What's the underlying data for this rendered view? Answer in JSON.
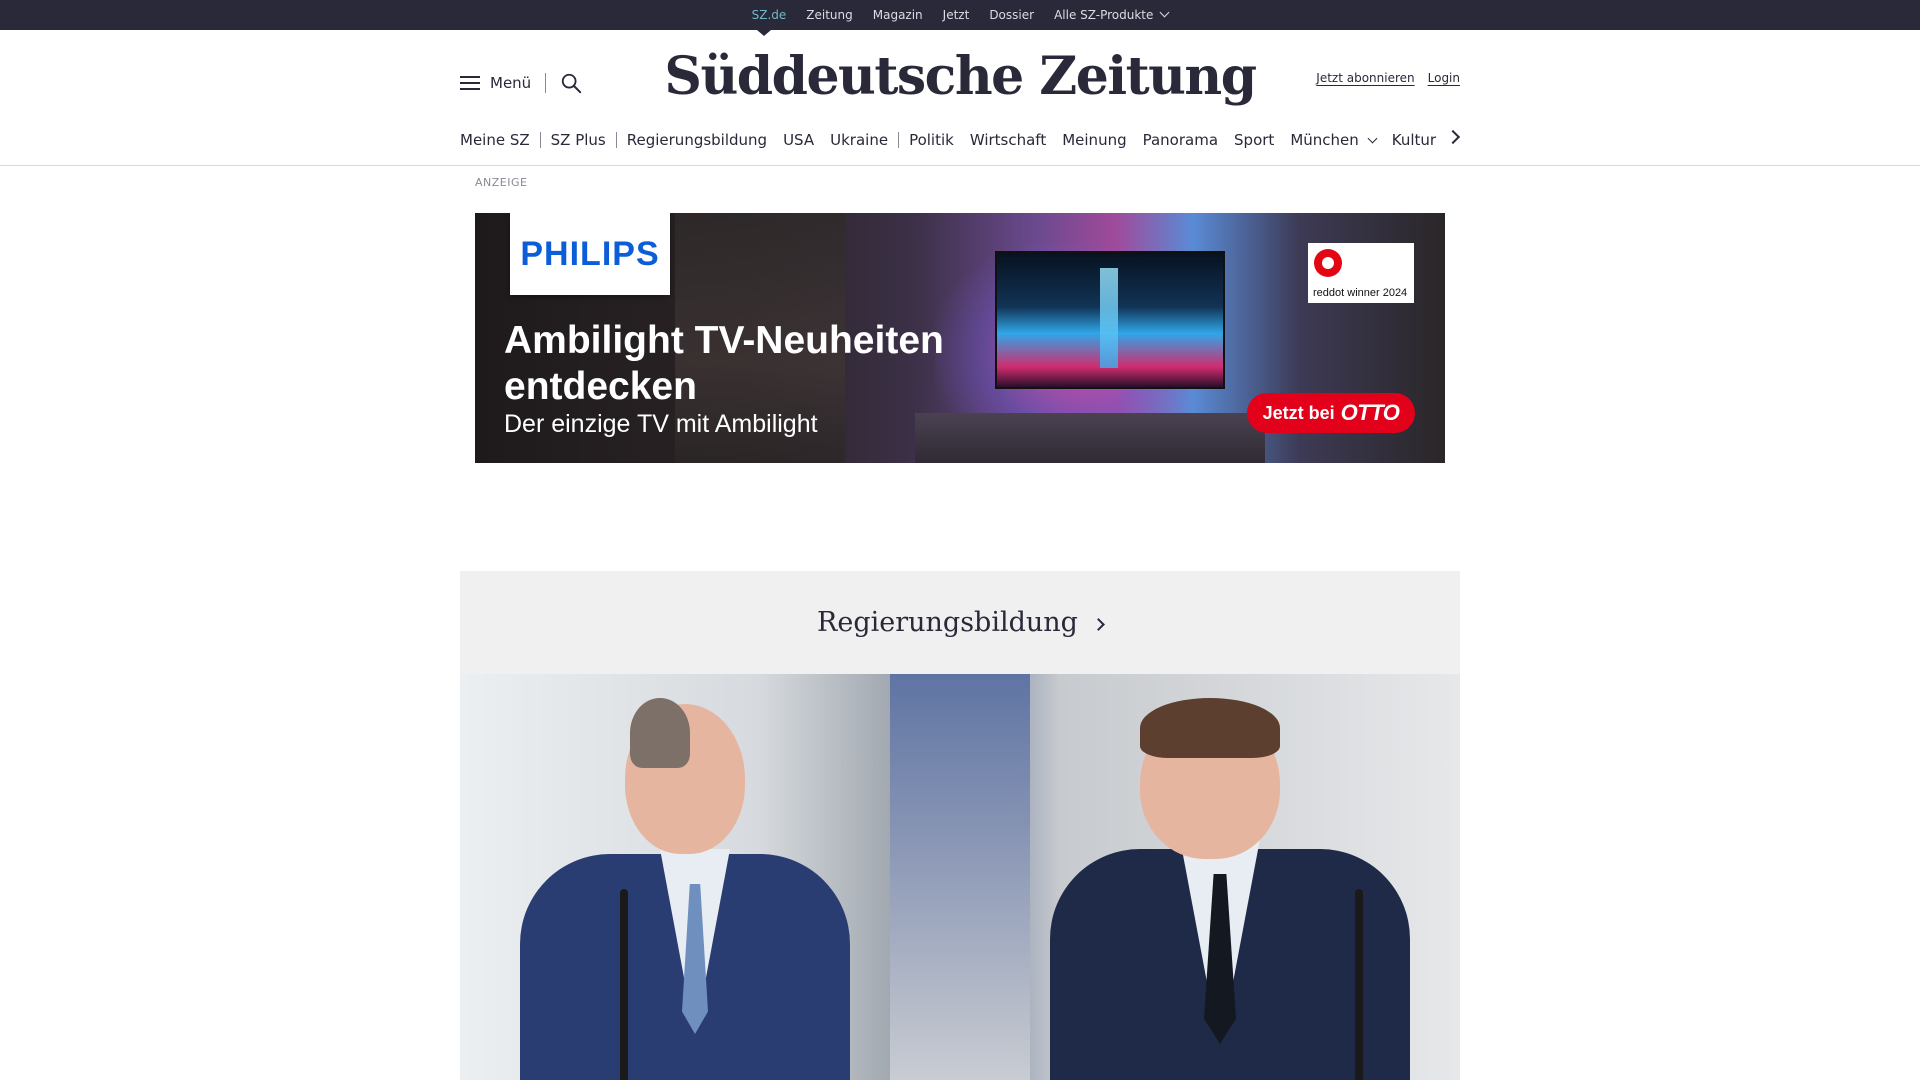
{
  "topbar": {
    "links": [
      "SZ.de",
      "Zeitung",
      "Magazin",
      "Jetzt",
      "Dossier",
      "Alle SZ-Produkte"
    ],
    "active_color": "#71b9c9",
    "background": "#29293a"
  },
  "header": {
    "menu_label": "Menü",
    "logo_text": "Süddeutsche Zeitung",
    "subscribe_label": "Jetzt abonnieren",
    "login_label": "Login",
    "icons": [
      "menu-icon",
      "search-icon"
    ]
  },
  "nav": {
    "items": [
      "Meine SZ",
      "SZ Plus",
      "Regierungsbildung",
      "USA",
      "Ukraine",
      "Politik",
      "Wirtschaft",
      "Meinung",
      "Panorama",
      "Sport",
      "München",
      "Kultur"
    ]
  },
  "ad": {
    "label": "ANZEIGE",
    "brand": "PHILIPS",
    "headline": "Ambilight TV-Neuheiten entdecken",
    "subline": "Der einzige TV mit Ambilight",
    "badge_text": "reddot winner 2024",
    "cta_prefix": "Jetzt bei",
    "cta_brand": "OTTO",
    "brand_color": "#0b5ed7",
    "cta_color": "#e3001b"
  },
  "teaser": {
    "title": "Regierungsbildung",
    "background": "#f0f0f0"
  }
}
